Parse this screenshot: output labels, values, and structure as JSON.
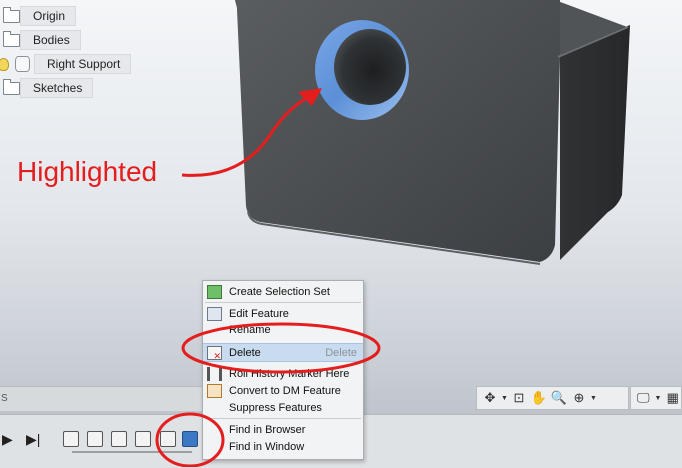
{
  "browser": {
    "items": [
      {
        "label": "Origin",
        "icon": "folder-icon"
      },
      {
        "label": "Bodies",
        "icon": "folder-icon"
      },
      {
        "label": "Right Support",
        "icon": "body-icon"
      },
      {
        "label": "Sketches",
        "icon": "folder-icon"
      }
    ]
  },
  "annotation": {
    "label": "Highlighted",
    "color": "#e41d1d"
  },
  "viewport": {
    "left_bar_text": "S"
  },
  "context_menu": {
    "items": [
      {
        "label": "Create Selection Set"
      },
      {
        "label": "Edit Feature"
      },
      {
        "label": "Rename"
      },
      {
        "label": "Delete",
        "shortcut": "Delete"
      },
      {
        "label": "Roll History Marker Here"
      },
      {
        "label": "Convert to DM Feature"
      },
      {
        "label": "Suppress Features"
      },
      {
        "label": "Find in Browser"
      },
      {
        "label": "Find in Window"
      }
    ]
  },
  "colors": {
    "highlight_blue": "#5b8fd6",
    "part_gray": "#4b4e51",
    "menu_highlight": "#c9dbef"
  }
}
